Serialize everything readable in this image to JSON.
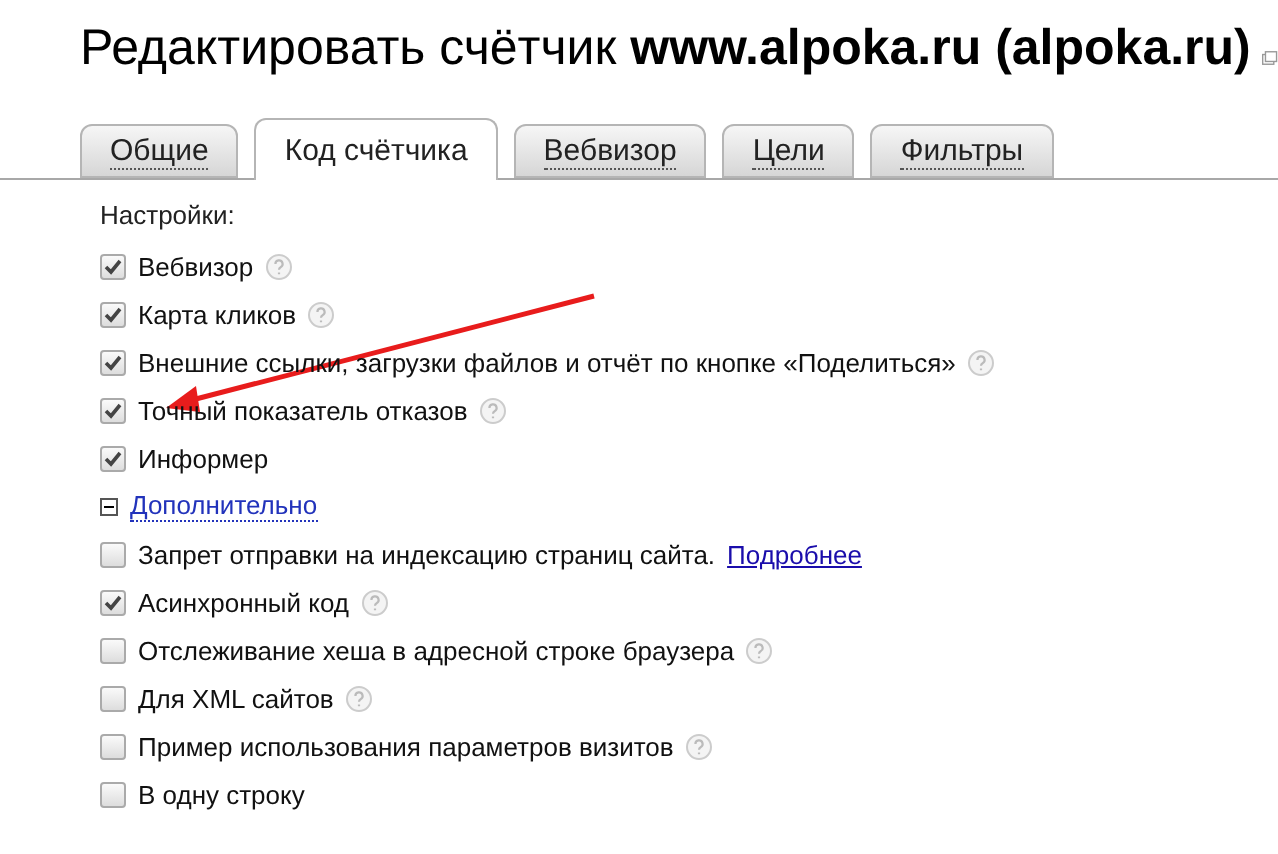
{
  "title": "Редактировать счётчик **www.alpoka.ru (alpoka.ru)**",
  "tabs": [
    {
      "label": "Общие",
      "selected": false
    },
    {
      "label": "Код счётчика",
      "selected": true
    },
    {
      "label": "Вебвизор",
      "selected": false
    },
    {
      "label": "Цели",
      "selected": false
    },
    {
      "label": "Фильтры",
      "selected": false
    }
  ],
  "settings_label": "Настройки:",
  "options": [
    {
      "label": "Вебвизор",
      "checked": true,
      "help": true
    },
    {
      "label": "Карта кликов",
      "checked": true,
      "help": true
    },
    {
      "label": "Внешние ссылки, загрузки файлов и отчёт по кнопке «Поделиться»",
      "checked": true,
      "help": true
    },
    {
      "label": "Точный показатель отказов",
      "checked": true,
      "help": true
    },
    {
      "label": "Информер",
      "checked": true,
      "help": false
    }
  ],
  "advanced": {
    "label": "Дополнительно",
    "expanded": true
  },
  "advanced_options": [
    {
      "label": "Запрет отправки на индексацию страниц сайта.",
      "link": "Подробнее",
      "checked": false,
      "help": false
    },
    {
      "label": "Асинхронный код",
      "checked": true,
      "help": true
    },
    {
      "label": "Отслеживание хеша в адресной строке браузера",
      "checked": false,
      "help": true
    },
    {
      "label": "Для XML сайтов",
      "checked": false,
      "help": true
    },
    {
      "label": "Пример использования параметров визитов",
      "checked": false,
      "help": true
    },
    {
      "label": "В одну строку",
      "checked": false,
      "help": false
    }
  ]
}
